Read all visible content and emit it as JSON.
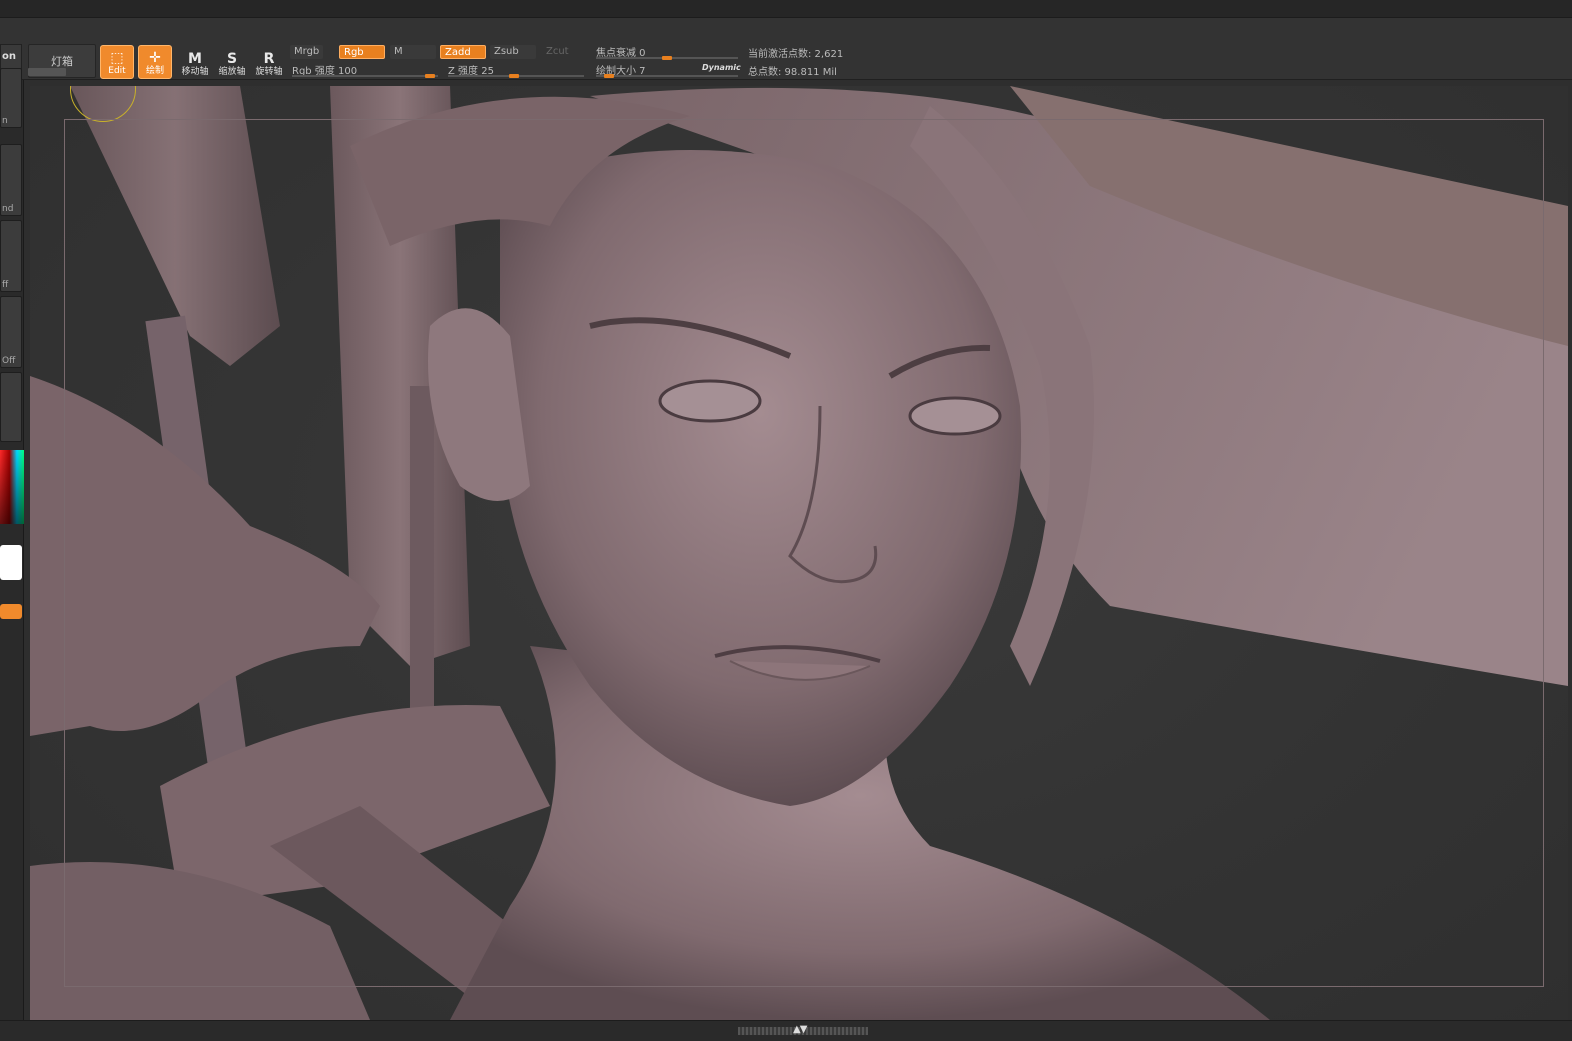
{
  "toolbar": {
    "left_tab_label": "on",
    "lightbox_label": "灯箱",
    "edit_label": "Edit",
    "draw_label": "绘制",
    "move_label": "移动轴",
    "scale_label": "缩放轴",
    "rotate_label": "旋转轴",
    "mrgb_label": "Mrgb",
    "rgb_label": "Rgb",
    "m_label": "M",
    "zadd_label": "Zadd",
    "zsub_label": "Zsub",
    "zcut_label": "Zcut",
    "rgb_intensity_label": "Rgb 强度 100",
    "z_intensity_label": "Z 强度 25",
    "focal_shift_label": "焦点衰减 0",
    "draw_size_label": "绘制大小 7",
    "dynamic_label": "Dynamic",
    "active_points_label": "当前激活点数: 2,621",
    "total_points_label": "总点数: 98.811 Mil",
    "accent_color": "#f08a2c",
    "rgb_intensity_value": 100,
    "z_intensity_value": 25,
    "focal_shift_value": 0,
    "draw_size_value": 7
  },
  "left_palette": {
    "labels": [
      "n",
      "nd",
      "ff",
      "Off"
    ]
  },
  "canvas": {
    "model_color": "#8b7479",
    "background": "#333333"
  }
}
